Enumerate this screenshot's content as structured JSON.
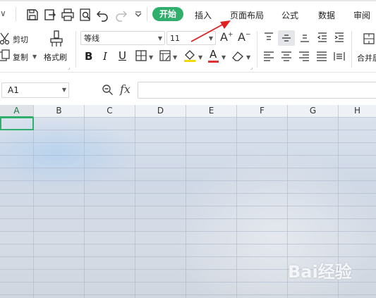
{
  "quick_access": {
    "menu_arrow_label": "∨",
    "icons": [
      "save-icon",
      "export-icon",
      "print-icon",
      "print-preview-icon",
      "undo-icon",
      "redo-icon",
      "more-icon"
    ]
  },
  "tabs": [
    {
      "label": "开始",
      "active": true
    },
    {
      "label": "插入",
      "active": false
    },
    {
      "label": "页面布局",
      "active": false
    },
    {
      "label": "公式",
      "active": false
    },
    {
      "label": "数据",
      "active": false
    },
    {
      "label": "审阅",
      "active": false
    }
  ],
  "ribbon": {
    "cut_label": "剪切",
    "copy_label": "复制",
    "format_painter_label": "格式刷",
    "font_name": "等线",
    "font_size": "11",
    "merge_label": "合并居",
    "colors": {
      "accent": "#2fae6c",
      "font_color": "#e03030",
      "highlight": "#f5d800"
    }
  },
  "formula_bar": {
    "cell_ref": "A1",
    "fx_label": "fx",
    "formula_value": ""
  },
  "columns": [
    "A",
    "B",
    "C",
    "D",
    "E",
    "F",
    "G",
    "H"
  ],
  "selected_column": "A",
  "annotation": {
    "arrow_color": "#e02020",
    "points_to": "页面布局"
  },
  "watermark": {
    "text": "Bai经验"
  }
}
